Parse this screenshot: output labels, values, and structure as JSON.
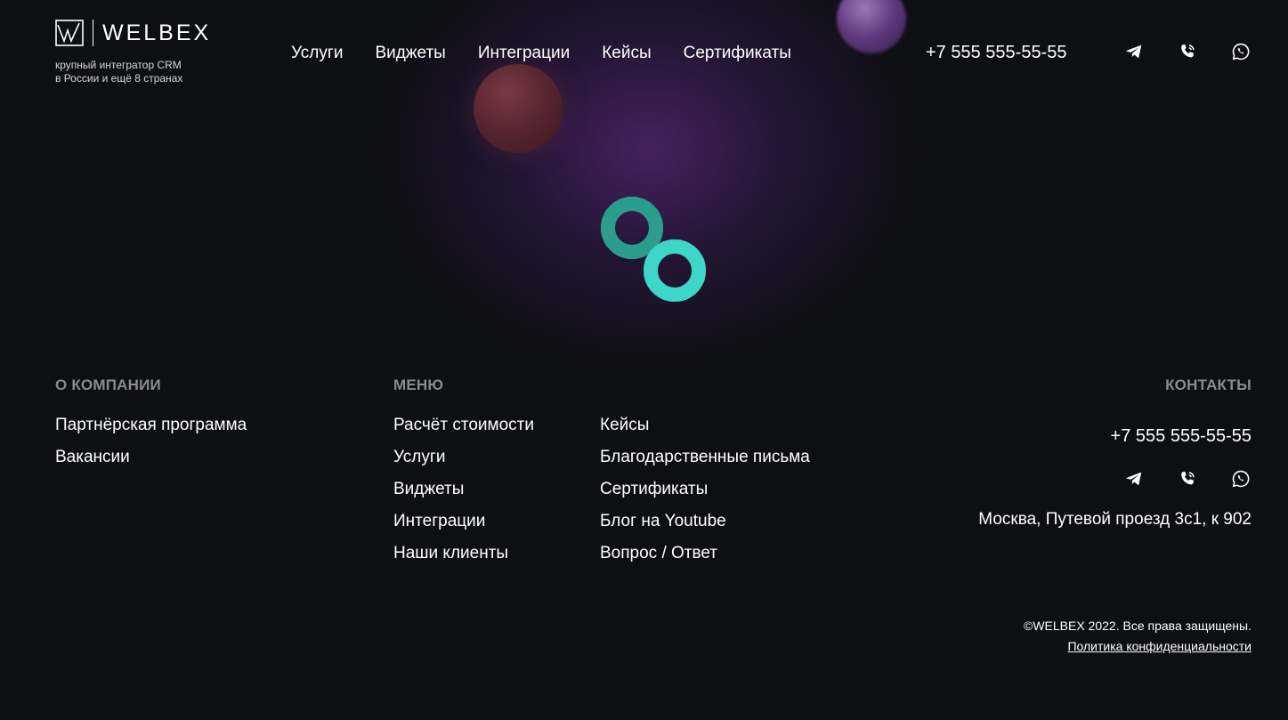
{
  "header": {
    "logo_text": "WELBEX",
    "tagline_line1": "крупный интегратор CRM",
    "tagline_line2": "в России и ещё 8 странах",
    "nav": [
      "Услуги",
      "Виджеты",
      "Интеграции",
      "Кейсы",
      "Сертификаты"
    ],
    "phone": "+7 555 555-55-55",
    "icons": [
      "telegram-icon",
      "phone-call-icon",
      "whatsapp-icon"
    ]
  },
  "loader": {
    "icon": "gears-icon",
    "colors": {
      "gear_dark": "#2a9d8f",
      "gear_light": "#3dd6c8"
    }
  },
  "footer": {
    "about": {
      "heading": "О КОМПАНИИ",
      "links": [
        "Партнёрская программа",
        "Вакансии"
      ]
    },
    "menu": {
      "heading": "МЕНЮ",
      "col1": [
        "Расчёт стоимости",
        "Услуги",
        "Виджеты",
        "Интеграции",
        "Наши клиенты"
      ],
      "col2": [
        "Кейсы",
        "Благодарственные письма",
        "Сертификаты",
        "Блог на Youtube",
        "Вопрос / Ответ"
      ]
    },
    "contacts": {
      "heading": "КОНТАКТЫ",
      "phone": "+7 555 555-55-55",
      "address": "Москва, Путевой проезд 3с1, к 902"
    },
    "copyright": "©WELBEX 2022. Все права защищены.",
    "privacy": "Политика конфиденциальности"
  },
  "colors": {
    "background": "#0e0f14",
    "heading_gray": "#8a8a8f",
    "glow_purple": "#582878"
  }
}
